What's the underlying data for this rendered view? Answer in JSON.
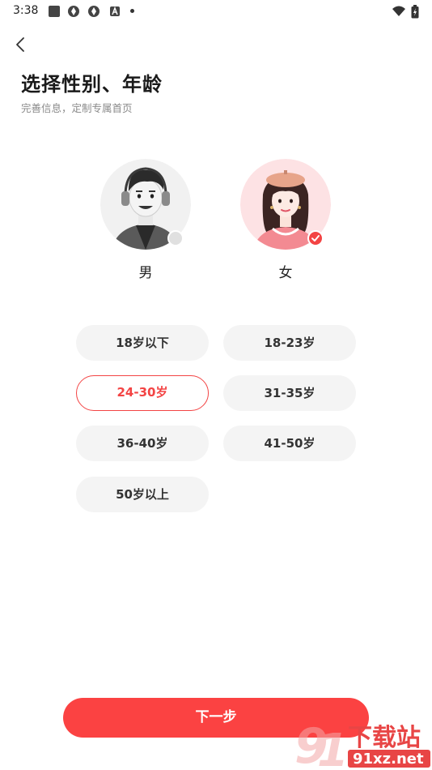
{
  "status_bar": {
    "time": "3:38",
    "left_icons": [
      "square-icon",
      "aperture-icon",
      "aperture-icon",
      "a-badge-icon",
      "dot-icon"
    ],
    "right_icons": [
      "wifi-icon",
      "battery-charging-icon"
    ]
  },
  "header": {
    "back_icon": "chevron-left-icon",
    "title": "选择性别、年龄",
    "subtitle": "完善信息，定制专属首页"
  },
  "gender": {
    "options": [
      {
        "label": "男",
        "selected": false,
        "avatar": "male-avatar"
      },
      {
        "label": "女",
        "selected": true,
        "avatar": "female-avatar"
      }
    ]
  },
  "age": {
    "options": [
      {
        "label": "18岁以下",
        "selected": false
      },
      {
        "label": "18-23岁",
        "selected": false
      },
      {
        "label": "24-30岁",
        "selected": true
      },
      {
        "label": "31-35岁",
        "selected": false
      },
      {
        "label": "36-40岁",
        "selected": false
      },
      {
        "label": "41-50岁",
        "selected": false
      },
      {
        "label": "50岁以上",
        "selected": false
      }
    ]
  },
  "footer": {
    "next_label": "下一步"
  },
  "watermark": {
    "logo_text": "下载站",
    "domain": "91xz.net"
  },
  "colors": {
    "accent": "#f34444",
    "button": "#fb4242",
    "chip_bg": "#f4f4f4",
    "title": "#1a1a1a",
    "subtitle": "#8a8a8a"
  }
}
